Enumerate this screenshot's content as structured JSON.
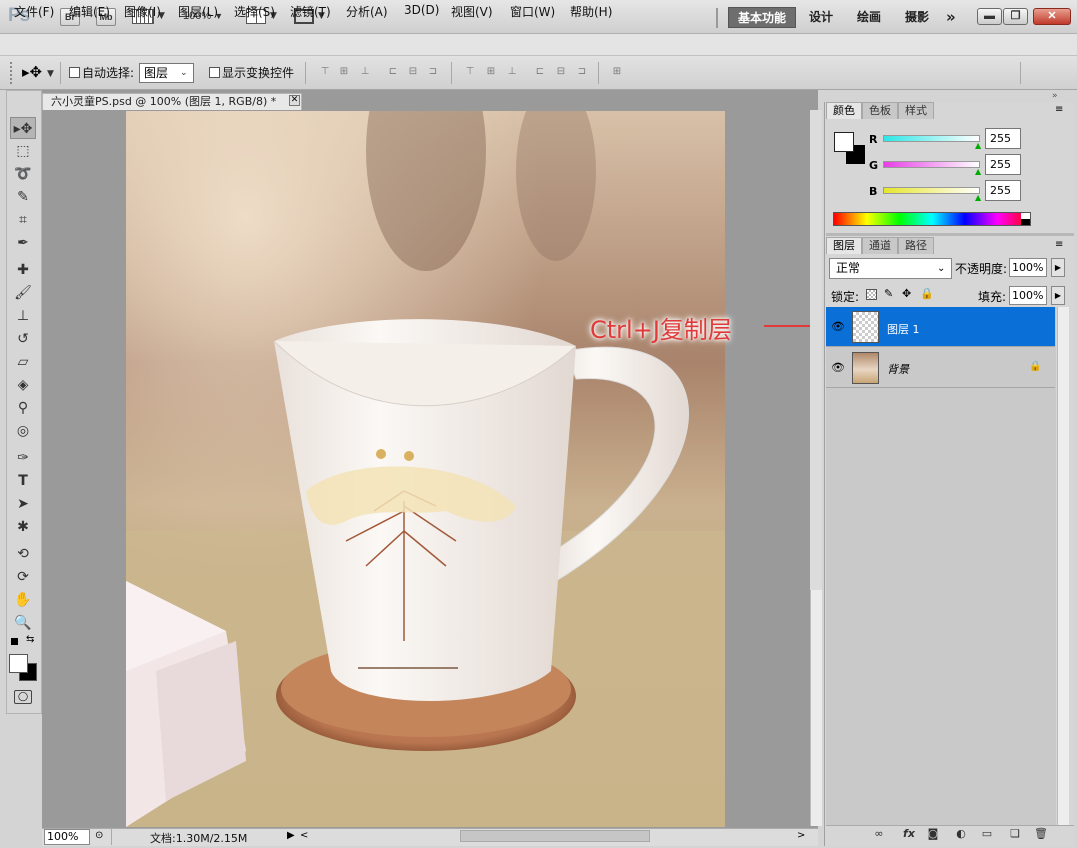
{
  "app": {
    "logo": "Ps",
    "bridge": "Br",
    "minibridge": "Mb",
    "zoom": "100%"
  },
  "workspaces": [
    "基本功能",
    "设计",
    "绘画",
    "摄影"
  ],
  "workspace_more": "»",
  "menu": [
    "文件(F)",
    "编辑(E)",
    "图像(I)",
    "图层(L)",
    "选择(S)",
    "滤镜(T)",
    "分析(A)",
    "3D(D)",
    "视图(V)",
    "窗口(W)",
    "帮助(H)"
  ],
  "options": {
    "auto_select_label": "自动选择:",
    "auto_select_value": "图层",
    "show_transform_label": "显示变换控件"
  },
  "document": {
    "tab_title": "六小灵童PS.psd @ 100% (图层 1, RGB/8) *",
    "zoom": "100%",
    "doc_info": "文档:1.30M/2.15M"
  },
  "color_panel": {
    "tabs": [
      "颜色",
      "色板",
      "样式"
    ],
    "channels": [
      {
        "label": "R",
        "value": "255",
        "color": "#2ee6e6"
      },
      {
        "label": "G",
        "value": "255",
        "color": "#e63ee6"
      },
      {
        "label": "B",
        "value": "255",
        "color": "#e6e62e"
      }
    ]
  },
  "layers_panel": {
    "tabs": [
      "图层",
      "通道",
      "路径"
    ],
    "blend_mode": "正常",
    "opacity_label": "不透明度:",
    "opacity": "100%",
    "lock_label": "锁定:",
    "fill_label": "填充:",
    "fill": "100%",
    "layers": [
      {
        "name": "图层 1",
        "selected": true
      },
      {
        "name": "背景",
        "selected": false,
        "locked": true
      }
    ]
  },
  "annotation": "Ctrl+J复制层",
  "colors": {
    "selection": "#0a6fd6",
    "annotation": "#e03a3a",
    "workspace_active": "#6e6e6e"
  }
}
